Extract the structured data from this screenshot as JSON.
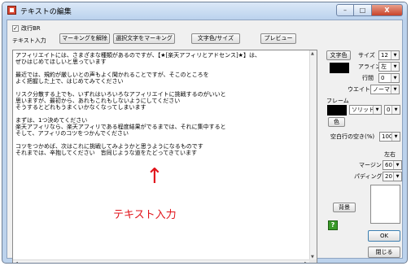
{
  "window": {
    "title": "テキストの編集",
    "min_label": "–",
    "max_label": "□",
    "close_label": "X"
  },
  "toolbar": {
    "line_break_checkbox": {
      "label": "改行BR",
      "checked": true
    },
    "text_input_label": "テキスト入力",
    "buttons": [
      "マーキングを解除",
      "選択文字をマーキング",
      "文字色/サイズ",
      "プレビュー"
    ]
  },
  "editor": {
    "lines": [
      "アフィリエイトには、さまざまな種類があるのですが、【★[楽天アフィリとアドセンス]★】は、",
      "ぜひはじめてほしいと思っています",
      "",
      "最近では、規約が厳しいとの声もよく聞かれることですが、そこのところを",
      "よく把握した上で、はじめてみてください",
      "",
      "リスク分散する上でも、いずれはいろいろなアフィリエイトに挑戦するのがいいと",
      "思いますが、最初から、あれもこれもしないようにしてください",
      "そうするとどれもうまくいかなくなってしまいます",
      "",
      "まずは、1つ決めてください",
      "楽天アフィリなら、楽天アフィリである程度結果がでるまでは、それに集中すると",
      "そして、アフィリのコツをつかんでください",
      "",
      "コツをつかめば、次はこれに挑戦してみようかと思うようになるものです",
      "それまでは、辛抱してください　皆同じような道をたどってきています"
    ]
  },
  "annotation": {
    "label": "テキスト入力",
    "arrow_glyph": "↑"
  },
  "right_panel": {
    "text_color_button": "文字色",
    "size_label": "サイズ",
    "size_value": "12",
    "align_label": "アライン",
    "align_value": "左",
    "line_spacing_label": "行間",
    "line_spacing_value": "0",
    "weight_label": "ウエイト",
    "weight_value": "ノーマル",
    "frame_label": "フレーム",
    "frame_style_value": "ソリッド",
    "frame_width_value": "0",
    "frame_color_button": "色",
    "empty_line_label": "空白行の空き(%)",
    "empty_line_value": "100",
    "lr_label": "左右",
    "margin_label": "マージン",
    "margin_value": "60",
    "padding_label": "パディング",
    "padding_value": "20",
    "background_button": "背景",
    "help_icon_label": "?",
    "ok_button": "OK",
    "close_button": "閉じる"
  },
  "colors": {
    "accent_red": "#e1141b",
    "text_color_swatch": "#000000",
    "frame_color_swatch": "#000000",
    "help_icon": "#3a9a2a"
  }
}
